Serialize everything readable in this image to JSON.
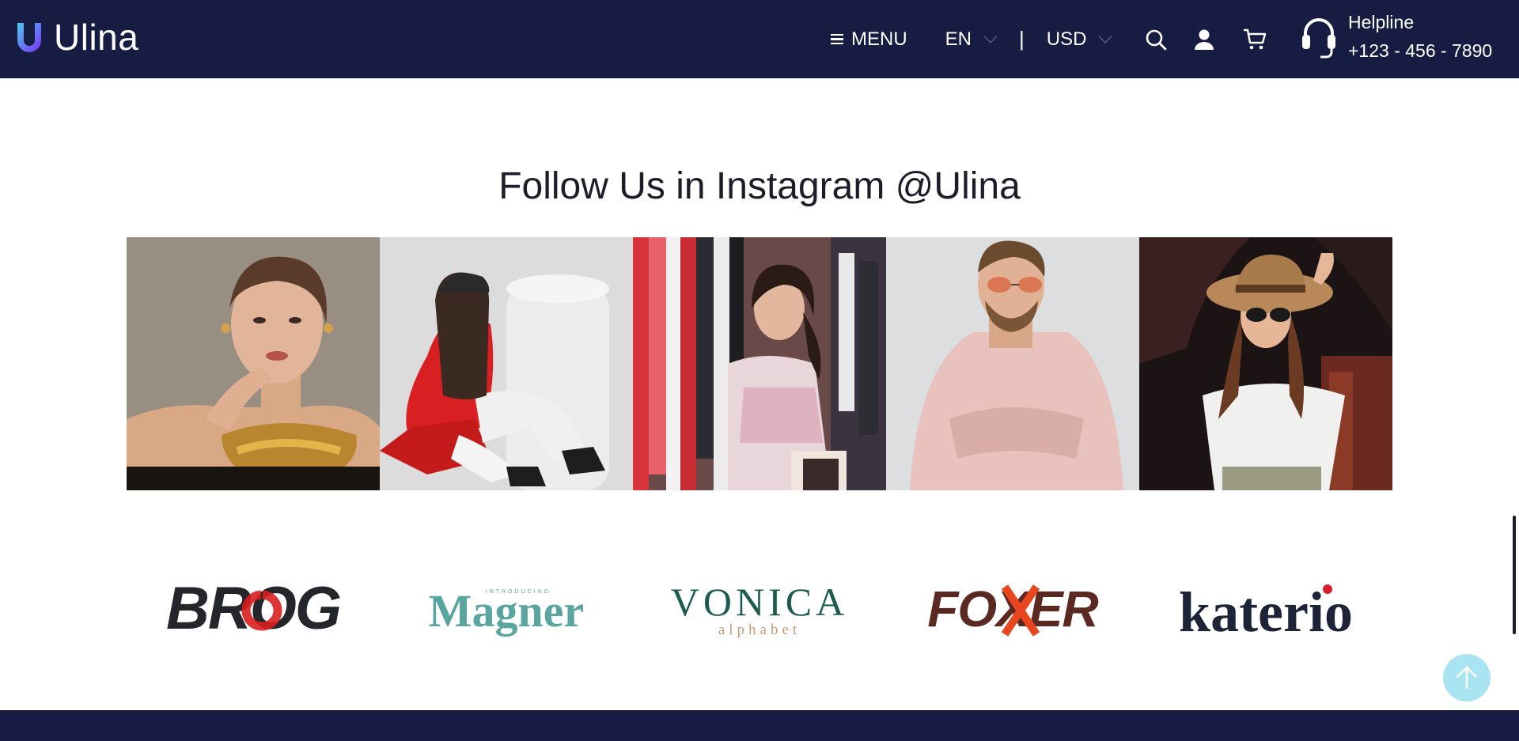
{
  "header": {
    "logo_text": "Ulina",
    "menu_label": "MENU",
    "language": "EN",
    "separator": "|",
    "currency": "USD",
    "helpline_label": "Helpline",
    "helpline_phone": "+123 - 456 - 7890"
  },
  "instagram": {
    "title": "Follow Us in Instagram @Ulina",
    "images": [
      "woman-with-gold-jewelry",
      "woman-in-red-coat",
      "woman-shopping-clothes",
      "man-with-sunglasses",
      "woman-with-sun-hat"
    ]
  },
  "brands": {
    "brog": "BROG",
    "magner": "Magner",
    "magner_small": "INTRODUCING",
    "vonica": "VONICA",
    "vonica_sub": "alphabet",
    "foxer": "FOXER",
    "katerio": "katerio"
  },
  "colors": {
    "header_bg": "#161c42",
    "accent_scroll": "#a8e4f1",
    "brog_red": "#d91f1f",
    "magner_teal": "#5aa5a0",
    "vonica_green": "#1d5a4f",
    "foxer_brown": "#5a2a22",
    "foxer_orange": "#e8461f",
    "katerio_navy": "#1d2438"
  },
  "icons": [
    "menu-icon",
    "chevron-down-icon",
    "search-icon",
    "user-icon",
    "cart-icon",
    "headset-icon",
    "arrow-up-icon"
  ]
}
